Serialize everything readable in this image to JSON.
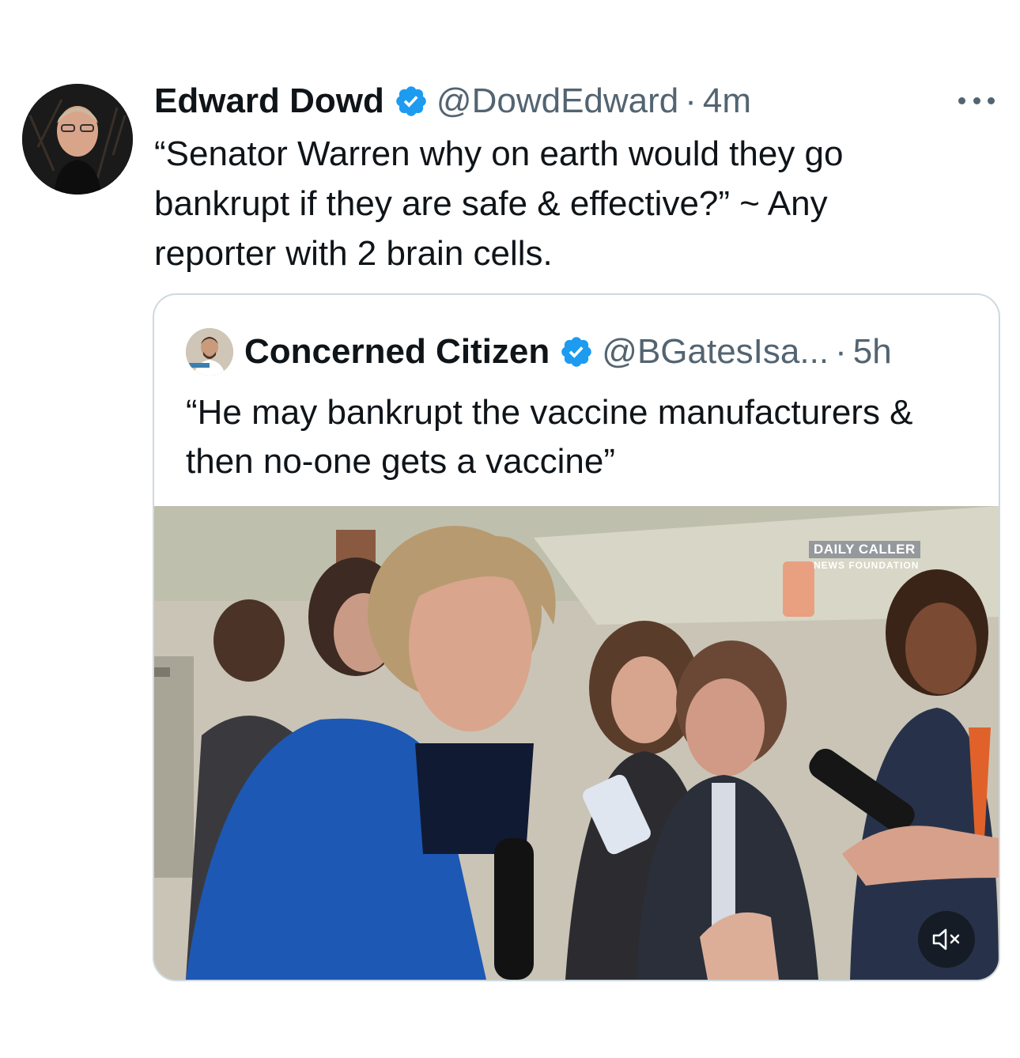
{
  "tweet": {
    "author_name": "Edward Dowd",
    "handle": "@DowdEdward",
    "separator": "·",
    "time": "4m",
    "text": "“Senator Warren why on earth would they go bankrupt if they are safe & effective?” ~ Any reporter with 2 brain cells."
  },
  "quoted_tweet": {
    "author_name": "Concerned Citizen",
    "handle": "@BGatesIsa...",
    "separator": "·",
    "time": "5h",
    "text": "“He may bankrupt the vaccine manufacturers & then no-one gets a vaccine”"
  },
  "media": {
    "watermark_line1": "DAILY CALLER",
    "watermark_line2": "NEWS FOUNDATION"
  },
  "colors": {
    "verified": "#1d9bf0",
    "secondary_text": "#536471",
    "border": "#cfd9de"
  },
  "icons": [
    "verified-badge-icon",
    "more-options-icon",
    "mute-icon"
  ]
}
